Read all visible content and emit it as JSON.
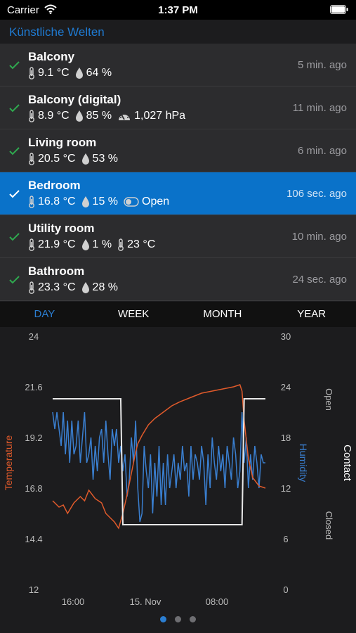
{
  "status_bar": {
    "carrier": "Carrier",
    "time": "1:37 PM"
  },
  "nav": {
    "title": "Künstliche Welten"
  },
  "sensors": [
    {
      "name": "Balcony",
      "ago": "5 min. ago",
      "readings": [
        {
          "icon": "thermometer-icon",
          "text": "9.1 °C"
        },
        {
          "icon": "humidity-drop-icon",
          "text": "64 %"
        }
      ]
    },
    {
      "name": "Balcony (digital)",
      "ago": "11 min. ago",
      "readings": [
        {
          "icon": "thermometer-icon",
          "text": "8.9 °C"
        },
        {
          "icon": "humidity-drop-icon",
          "text": "85 %"
        },
        {
          "icon": "gauge-icon",
          "text": "1,027 hPa"
        }
      ]
    },
    {
      "name": "Living room",
      "ago": "6 min. ago",
      "readings": [
        {
          "icon": "thermometer-icon",
          "text": "20.5 °C"
        },
        {
          "icon": "humidity-drop-icon",
          "text": "53 %"
        }
      ]
    },
    {
      "name": "Bedroom",
      "ago": "106 sec. ago",
      "selected": true,
      "readings": [
        {
          "icon": "thermometer-icon",
          "text": "16.8 °C"
        },
        {
          "icon": "humidity-drop-icon",
          "text": "15 %"
        },
        {
          "icon": "toggle-icon",
          "text": "Open"
        }
      ]
    },
    {
      "name": "Utility room",
      "ago": "10 min. ago",
      "readings": [
        {
          "icon": "thermometer-icon",
          "text": "21.9 °C"
        },
        {
          "icon": "humidity-drop-icon",
          "text": "1 %"
        },
        {
          "icon": "thermometer-icon",
          "text": "23 °C"
        }
      ]
    },
    {
      "name": "Bathroom",
      "ago": "24 sec. ago",
      "readings": [
        {
          "icon": "thermometer-icon",
          "text": "23.3 °C"
        },
        {
          "icon": "humidity-drop-icon",
          "text": "28 %"
        }
      ]
    }
  ],
  "tabs": [
    {
      "label": "DAY",
      "active": true
    },
    {
      "label": "WEEK"
    },
    {
      "label": "MONTH"
    },
    {
      "label": "YEAR"
    }
  ],
  "colors": {
    "accent": "#2b7ed1",
    "selected_row": "#0a72c9",
    "temperature": "#e05a2b",
    "humidity": "#3a7fd0",
    "contact": "#e8e8e8",
    "check": "#2fa84f"
  },
  "chart_data": {
    "type": "line",
    "x_ticks": [
      "16:00",
      "15. Nov",
      "08:00"
    ],
    "y_left": {
      "label": "Temperature",
      "ticks": [
        "24",
        "21.6",
        "19.2",
        "16.8",
        "14.4",
        "12"
      ],
      "range": [
        12,
        24
      ]
    },
    "y_right": {
      "label": "Humidity",
      "ticks": [
        "30",
        "24",
        "18",
        "12",
        "6",
        "0"
      ],
      "range": [
        0,
        30
      ]
    },
    "contact_axis": {
      "label": "Contact",
      "states": [
        "Open",
        "Closed"
      ]
    },
    "x_range": [
      0,
      100
    ],
    "series": [
      {
        "name": "Temperature",
        "axis": "left",
        "x": [
          0,
          3,
          5,
          7,
          10,
          13,
          15,
          17,
          20,
          23,
          25,
          27,
          29,
          31,
          33,
          35,
          37,
          38,
          39,
          40,
          42,
          45,
          48,
          52,
          56,
          60,
          65,
          70,
          75,
          80,
          85,
          88,
          89,
          90,
          92,
          94,
          97,
          100
        ],
        "y": [
          16.2,
          15.9,
          16,
          15.6,
          16.1,
          16.4,
          16.2,
          16.7,
          16.3,
          16.1,
          15.6,
          15.4,
          15.2,
          14.9,
          15.6,
          16.5,
          17.5,
          18,
          18.5,
          18.9,
          19.3,
          19.8,
          20.1,
          20.4,
          20.7,
          20.9,
          21.1,
          21.3,
          21.4,
          21.5,
          21.6,
          21.7,
          21.4,
          20,
          18.2,
          17.3,
          16.9,
          16.8
        ]
      },
      {
        "name": "Humidity",
        "axis": "right",
        "x": [
          0,
          1,
          2,
          3,
          4,
          5,
          6,
          7,
          8,
          9,
          10,
          11,
          12,
          13,
          14,
          15,
          16,
          17,
          18,
          19,
          20,
          21,
          22,
          23,
          24,
          25,
          26,
          27,
          28,
          29,
          30,
          31,
          32,
          33,
          34,
          35,
          36,
          37,
          38,
          39,
          40,
          41,
          42,
          43,
          44,
          45,
          46,
          47,
          48,
          49,
          50,
          51,
          52,
          53,
          54,
          55,
          56,
          57,
          58,
          59,
          60,
          61,
          62,
          63,
          64,
          65,
          66,
          67,
          68,
          69,
          70,
          71,
          72,
          73,
          74,
          75,
          76,
          77,
          78,
          79,
          80,
          81,
          82,
          83,
          84,
          85,
          86,
          87,
          88,
          89,
          90,
          91,
          92,
          93,
          94,
          95,
          96,
          97,
          98,
          99,
          100
        ],
        "y": [
          21,
          19,
          21,
          19,
          17,
          21,
          16,
          20,
          15,
          20,
          16,
          17,
          20,
          15,
          18,
          21,
          15,
          16,
          18,
          13,
          17,
          14,
          18,
          19,
          15,
          20,
          16,
          13,
          19,
          17,
          19,
          15,
          17,
          14,
          16,
          11,
          13,
          18,
          15,
          20,
          12,
          8,
          9,
          17,
          14,
          12,
          16,
          9,
          15,
          11,
          17,
          10,
          15,
          10,
          16,
          12,
          14,
          16,
          12,
          15,
          13,
          17,
          14,
          15,
          11,
          17,
          13,
          16,
          15,
          13,
          17,
          15,
          10,
          16,
          12,
          18,
          15,
          13,
          17,
          14,
          16,
          12,
          17,
          15,
          13,
          18,
          16,
          12,
          14,
          21,
          15,
          18,
          12,
          16,
          13,
          17,
          15,
          12,
          16,
          15,
          15
        ]
      },
      {
        "name": "Contact",
        "axis": "contact",
        "x": [
          0,
          32,
          33,
          89,
          90,
          100
        ],
        "state": [
          "Open",
          "Open",
          "Closed",
          "Closed",
          "Open",
          "Open"
        ]
      }
    ]
  }
}
